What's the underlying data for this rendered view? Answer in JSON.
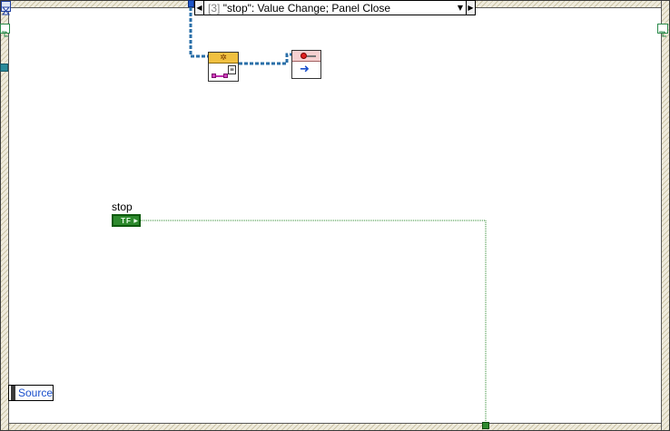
{
  "case_selector": {
    "index": "[3]",
    "event": "\"stop\": Value Change;  Panel Close"
  },
  "stop_terminal": {
    "label": "stop",
    "type_text": "TF"
  },
  "source": {
    "label": "Source"
  },
  "icons": {
    "property_node": "property-node-icon",
    "stop_node": "stop-function-icon",
    "event_data": "event-data-terminal-icon"
  },
  "colors": {
    "frame_hatch": "#cdc6a8",
    "boolean_green": "#2e8a2e",
    "refnum_wire": "#2a6fa8",
    "event_terminal": "#1e56c8"
  }
}
